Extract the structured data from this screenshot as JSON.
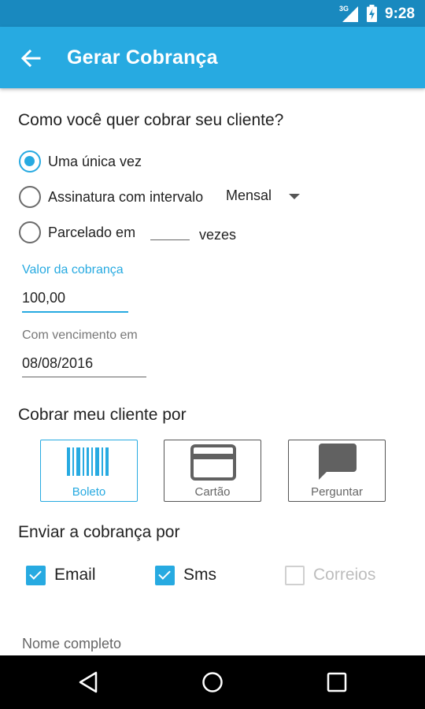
{
  "status_bar": {
    "network": "3G",
    "time": "9:28"
  },
  "app_bar": {
    "title": "Gerar Cobrança"
  },
  "charge_type": {
    "heading": "Como você quer cobrar seu cliente?",
    "options": [
      {
        "label": "Uma única vez",
        "checked": true
      },
      {
        "label": "Assinatura com intervalo",
        "checked": false
      },
      {
        "label": "Parcelado em",
        "checked": false
      }
    ],
    "interval_value": "Mensal",
    "installments_value": "",
    "installments_suffix": "vezes"
  },
  "amount": {
    "label": "Valor da cobrança",
    "value": "100,00"
  },
  "due_date": {
    "label": "Com vencimento em",
    "value": "08/08/2016"
  },
  "payment": {
    "heading": "Cobrar meu cliente por",
    "methods": [
      {
        "label": "Boleto",
        "icon": "barcode-icon",
        "selected": true
      },
      {
        "label": "Cartão",
        "icon": "credit-card-icon",
        "selected": false
      },
      {
        "label": "Perguntar",
        "icon": "chat-bubble-icon",
        "selected": false
      }
    ]
  },
  "send": {
    "heading": "Enviar a cobrança por",
    "options": [
      {
        "label": "Email",
        "checked": true,
        "enabled": true
      },
      {
        "label": "Sms",
        "checked": true,
        "enabled": true
      },
      {
        "label": "Correios",
        "checked": false,
        "enabled": false
      }
    ]
  },
  "customer": {
    "name_label": "Nome completo"
  },
  "colors": {
    "accent": "#27aae1",
    "status_bar": "#1989bf",
    "nav_bar": "#000000"
  }
}
